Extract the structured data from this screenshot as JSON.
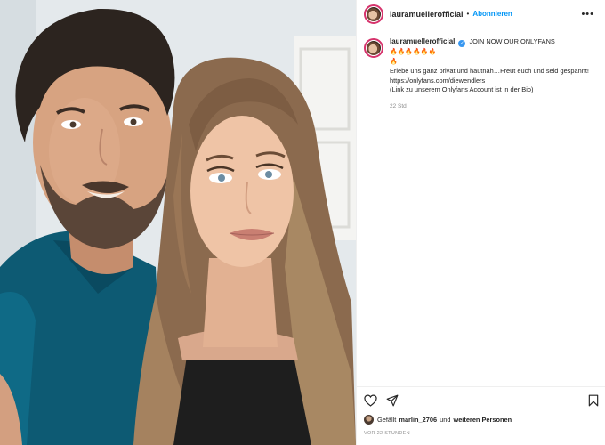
{
  "post": {
    "username": "lauramuellerofficial",
    "separator": "•",
    "follow_label": "Abonnieren",
    "more_label": "•••"
  },
  "caption": {
    "username": "lauramuellerofficial",
    "verified_mark": "✓",
    "line1": "JOIN NOW OUR ONLYFANS",
    "fire_emojis": "🔥🔥🔥🔥🔥🔥",
    "fire_emoji_line2": "🔥",
    "line2": "Erlebe uns ganz privat und hautnah…Freut euch und seid gespannt!",
    "line3": "https://onlyfans.com/diewendlers",
    "line4": "(Link zu unserem Onlyfans Account ist in der Bio)",
    "time_ago": "22 Std."
  },
  "actions": {
    "like_icon": "heart-icon",
    "share_icon": "paper-plane-icon",
    "save_icon": "bookmark-icon"
  },
  "likes": {
    "prefix": "Gefällt",
    "user": "marlin_2706",
    "connector": "und",
    "others": "weiteren Personen"
  },
  "timestamp": "VOR 22 STUNDEN",
  "colors": {
    "accent_blue": "#0095f6",
    "verified_blue": "#3897f0",
    "story_ring": "#d6336c",
    "muted_text": "#8e8e8e"
  }
}
